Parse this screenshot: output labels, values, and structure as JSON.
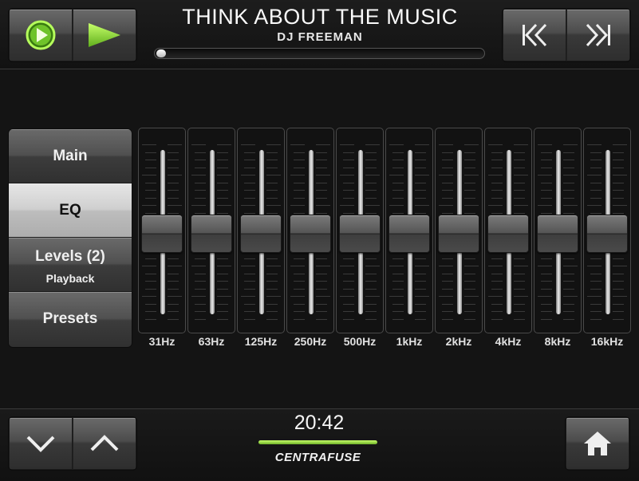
{
  "now_playing": {
    "title": "THINK ABOUT THE MUSIC",
    "artist": "DJ FREEMAN",
    "progress": 0.015
  },
  "controls": {
    "play_icon": "play-circle-icon",
    "play_arrow_icon": "play-arrow-icon",
    "previous_icon": "previous-track-icon",
    "next_icon": "next-track-icon"
  },
  "menu": {
    "items": [
      {
        "label": "Main",
        "sub": ""
      },
      {
        "label": "EQ",
        "sub": ""
      },
      {
        "label": "Levels  (2)",
        "sub": "Playback"
      },
      {
        "label": "Presets",
        "sub": ""
      }
    ],
    "active_index": 1
  },
  "eq": {
    "bands": [
      {
        "label": "31Hz",
        "level": 0.5
      },
      {
        "label": "63Hz",
        "level": 0.5
      },
      {
        "label": "125Hz",
        "level": 0.5
      },
      {
        "label": "250Hz",
        "level": 0.5
      },
      {
        "label": "500Hz",
        "level": 0.5
      },
      {
        "label": "1kHz",
        "level": 0.5
      },
      {
        "label": "2kHz",
        "level": 0.5
      },
      {
        "label": "4kHz",
        "level": 0.5
      },
      {
        "label": "8kHz",
        "level": 0.5
      },
      {
        "label": "16kHz",
        "level": 0.5
      }
    ]
  },
  "footer": {
    "clock": "20:42",
    "brand": "CENTRAFUSE",
    "down_icon": "chevron-down-icon",
    "up_icon": "chevron-up-icon",
    "home_icon": "home-icon"
  },
  "colors": {
    "accent_green": "#8cd633",
    "background": "#141414"
  }
}
